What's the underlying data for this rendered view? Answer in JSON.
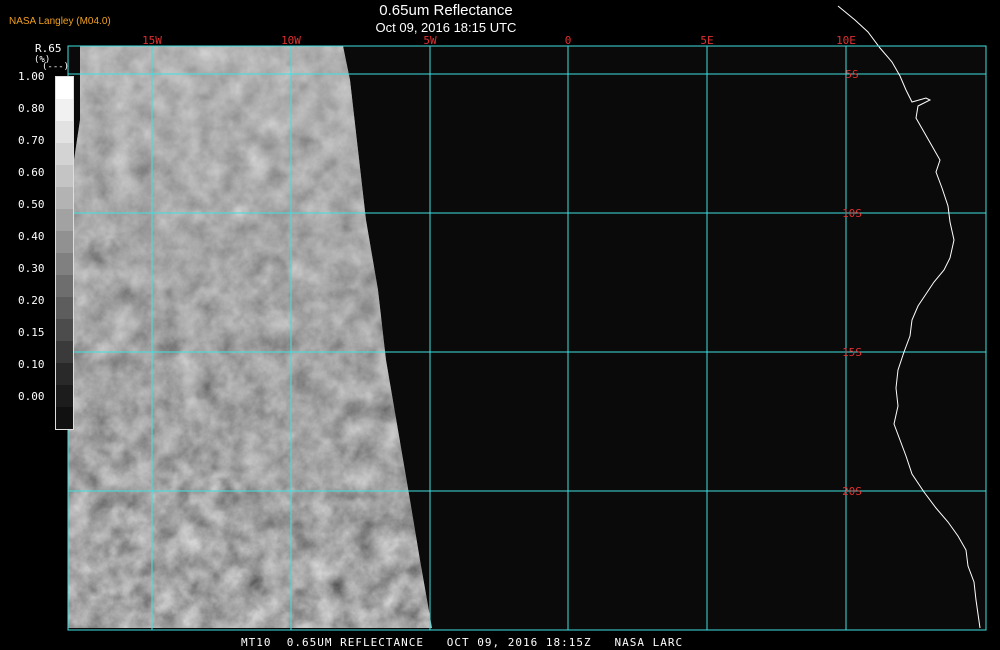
{
  "credit": "NASA Langley (M04.0)",
  "title": "0.65um Reflectance",
  "subtitle": "Oct 09, 2016 18:15 UTC",
  "footer": "MT10  0.65UM REFLECTANCE   OCT 09, 2016 18:15Z   NASA LARC",
  "legend": {
    "name": "R.65",
    "unit": "(%)",
    "subunit": "(---)",
    "ticks": [
      "1.00",
      "0.80",
      "0.70",
      "0.60",
      "0.50",
      "0.40",
      "0.30",
      "0.20",
      "0.15",
      "0.10",
      "0.00"
    ],
    "swatches": [
      "#ffffff",
      "#f1f1f1",
      "#e2e2e2",
      "#d3d3d3",
      "#c4c4c4",
      "#b3b3b3",
      "#a2a2a2",
      "#919191",
      "#808080",
      "#6e6e6e",
      "#5d5d5d",
      "#4c4c4c",
      "#3a3a3a",
      "#292929",
      "#1c1c1c",
      "#111111"
    ]
  },
  "grid": {
    "color": "#40e0e0",
    "label_color": "#e03030",
    "longitudes": [
      "15W",
      "10W",
      "5W",
      "0",
      "5E",
      "10E"
    ],
    "latitudes": [
      "5S",
      "10S",
      "15S",
      "20S"
    ]
  },
  "colors": {
    "background": "#0a0a0a",
    "coast": "#ffffff"
  }
}
